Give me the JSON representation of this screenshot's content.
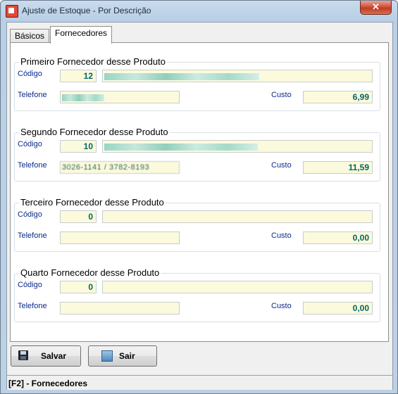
{
  "window": {
    "title": "Ajuste de Estoque - Por Descrição",
    "close_label": "✕"
  },
  "tabs": [
    {
      "label": "Básicos"
    },
    {
      "label": "Fornecedores"
    }
  ],
  "labels": {
    "codigo": "Código",
    "telefone": "Telefone",
    "custo": "Custo"
  },
  "suppliers": [
    {
      "title": "Primeiro Fornecedor desse Produto",
      "codigo": "12",
      "nome": "",
      "telefone": "",
      "custo": "6,99"
    },
    {
      "title": "Segundo Fornecedor desse Produto",
      "codigo": "10",
      "nome": "",
      "telefone": "3026-1141 / 3782-8193",
      "custo": "11,59"
    },
    {
      "title": "Terceiro Fornecedor desse Produto",
      "codigo": "0",
      "nome": "",
      "telefone": "",
      "custo": "0,00"
    },
    {
      "title": "Quarto Fornecedor desse Produto",
      "codigo": "0",
      "nome": "",
      "telefone": "",
      "custo": "0,00"
    }
  ],
  "buttons": {
    "salvar": "Salvar",
    "sair": "Sair"
  },
  "status": {
    "text": "[F2] - Fornecedores"
  }
}
